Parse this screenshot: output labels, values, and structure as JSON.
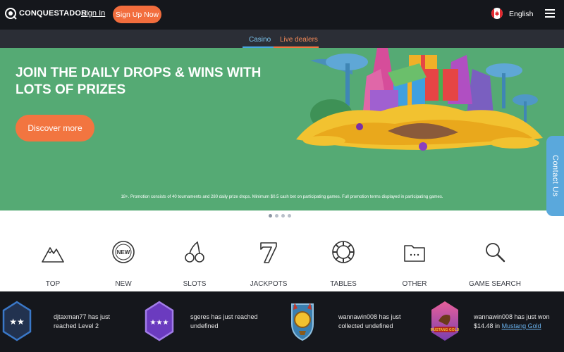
{
  "header": {
    "logo_text": "CONQUESTADOR",
    "signin_label": "Sign In",
    "signup_label": "Sign Up Now",
    "language": "English"
  },
  "subnav": {
    "tabs": [
      {
        "label": "Casino",
        "color": "#7cc6f0"
      },
      {
        "label": "Live dealers",
        "color": "#f58a58"
      }
    ]
  },
  "hero": {
    "title": "JOIN THE DAILY DROPS & WINS WITH LOTS OF PRIZES",
    "button_label": "Discover more",
    "disclaimer": "18+. Promotion consists of 40 tournaments and 280 daily prize drops. Minimum $0.5 cash bet on participating games. Full promotion terms displayed in participating games.",
    "background_color": "#55aa74",
    "accent_color": "#f27540"
  },
  "contact": {
    "label": "Contact Us"
  },
  "carousel": {
    "dot_count": 4,
    "active_index": 0
  },
  "categories": [
    {
      "label": "TOP",
      "icon": "mountain-icon"
    },
    {
      "label": "NEW",
      "icon": "new-badge-icon"
    },
    {
      "label": "SLOTS",
      "icon": "cherries-icon"
    },
    {
      "label": "JACKPOTS",
      "icon": "seven-icon"
    },
    {
      "label": "TABLES",
      "icon": "chip-icon"
    },
    {
      "label": "OTHER",
      "icon": "folder-icon"
    },
    {
      "label": "GAME SEARCH",
      "icon": "magnifier-icon"
    }
  ],
  "activity": [
    {
      "line1": "djtaxman77 has just",
      "line2": "reached Level 2",
      "badge": "two-star-level-icon"
    },
    {
      "line1": "sgeres has just reached",
      "line2": "undefined",
      "badge": "three-star-level-icon"
    },
    {
      "line1": "wannawin008 has just",
      "line2": "collected undefined",
      "badge": "trophy-shield-icon"
    },
    {
      "line1": "wannawin008 has just won",
      "line2": "$14.48 in",
      "link": "Mustang Gold",
      "badge": "mustang-gold-game-icon",
      "badge_text": "MUSTANG GOLD"
    }
  ]
}
